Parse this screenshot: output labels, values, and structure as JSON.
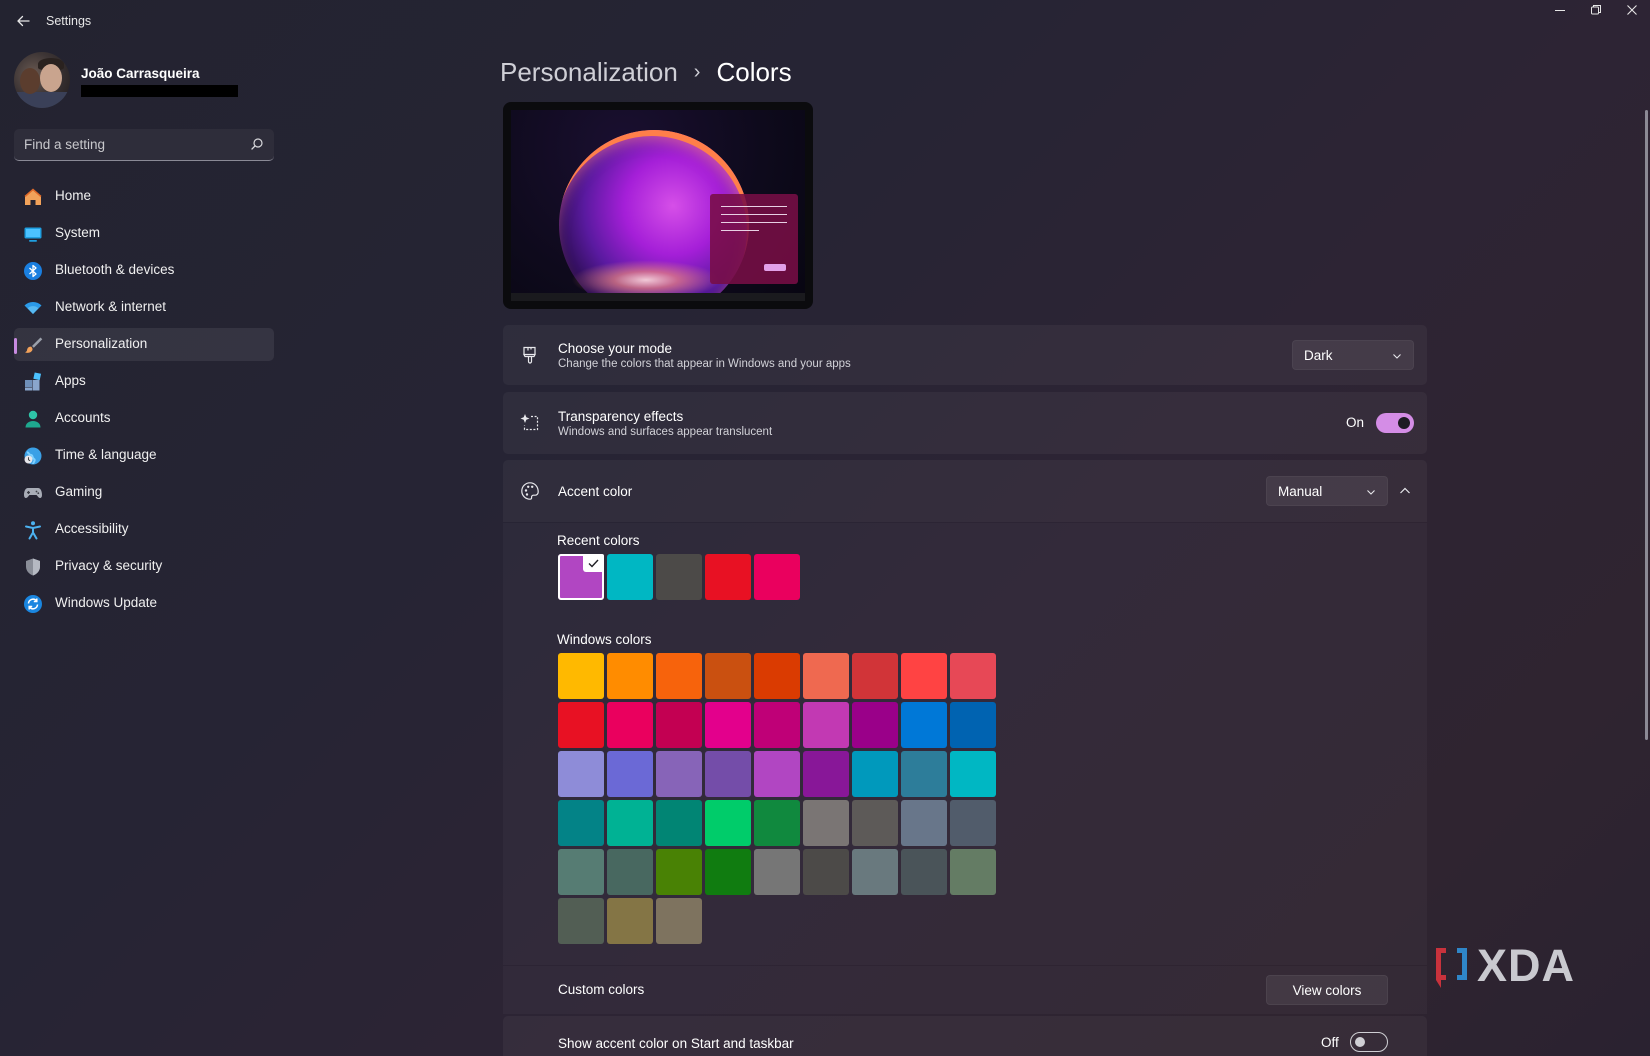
{
  "app": {
    "title": "Settings"
  },
  "profile": {
    "name": "João Carrasqueira"
  },
  "search": {
    "placeholder": "Find a setting"
  },
  "sidebar": {
    "items": [
      {
        "label": "Home",
        "icon": "home-icon"
      },
      {
        "label": "System",
        "icon": "system-icon"
      },
      {
        "label": "Bluetooth & devices",
        "icon": "bluetooth-icon"
      },
      {
        "label": "Network & internet",
        "icon": "wifi-icon"
      },
      {
        "label": "Personalization",
        "icon": "brush-icon",
        "active": true
      },
      {
        "label": "Apps",
        "icon": "apps-icon"
      },
      {
        "label": "Accounts",
        "icon": "accounts-icon"
      },
      {
        "label": "Time & language",
        "icon": "globe-clock-icon"
      },
      {
        "label": "Gaming",
        "icon": "gamepad-icon"
      },
      {
        "label": "Accessibility",
        "icon": "accessibility-icon"
      },
      {
        "label": "Privacy & security",
        "icon": "shield-icon"
      },
      {
        "label": "Windows Update",
        "icon": "update-icon"
      }
    ]
  },
  "breadcrumb": {
    "parent": "Personalization",
    "separator": "›",
    "current": "Colors"
  },
  "mode": {
    "title": "Choose your mode",
    "description": "Change the colors that appear in Windows and your apps",
    "value": "Dark"
  },
  "transparency": {
    "title": "Transparency effects",
    "description": "Windows and surfaces appear translucent",
    "state": "On"
  },
  "accent": {
    "title": "Accent color",
    "value": "Manual",
    "recent_label": "Recent colors",
    "recent_colors": [
      "#b146c2",
      "#00b7c3",
      "#4c4a48",
      "#e81123",
      "#ea005e"
    ],
    "selected_index": 0,
    "windows_label": "Windows colors",
    "windows_colors": [
      "#ffb900",
      "#ff8c00",
      "#f7630c",
      "#ca5010",
      "#da3b01",
      "#ef6950",
      "#d13438",
      "#ff4343",
      "#e74856",
      "#e81123",
      "#ea005e",
      "#c30052",
      "#e3008c",
      "#bf0077",
      "#c239b3",
      "#9a0089",
      "#0078d7",
      "#0063b1",
      "#8e8cd8",
      "#6b69d6",
      "#8764b8",
      "#744da9",
      "#b146c2",
      "#881798",
      "#0099bc",
      "#2d7d9a",
      "#00b7c3",
      "#038387",
      "#00b294",
      "#018574",
      "#00cc6a",
      "#10893e",
      "#7a7574",
      "#5d5a58",
      "#68768a",
      "#515c6b",
      "#567c73",
      "#486860",
      "#498205",
      "#107c10",
      "#767676",
      "#4c4a48",
      "#69797e",
      "#4a5459",
      "#647c64",
      "#525e54",
      "#847545",
      "#7e735f"
    ],
    "custom_label": "Custom colors",
    "view_colors_button": "View colors"
  },
  "taskbar_accent": {
    "title": "Show accent color on Start and taskbar",
    "state": "Off"
  },
  "watermark": {
    "text": "XDA"
  }
}
